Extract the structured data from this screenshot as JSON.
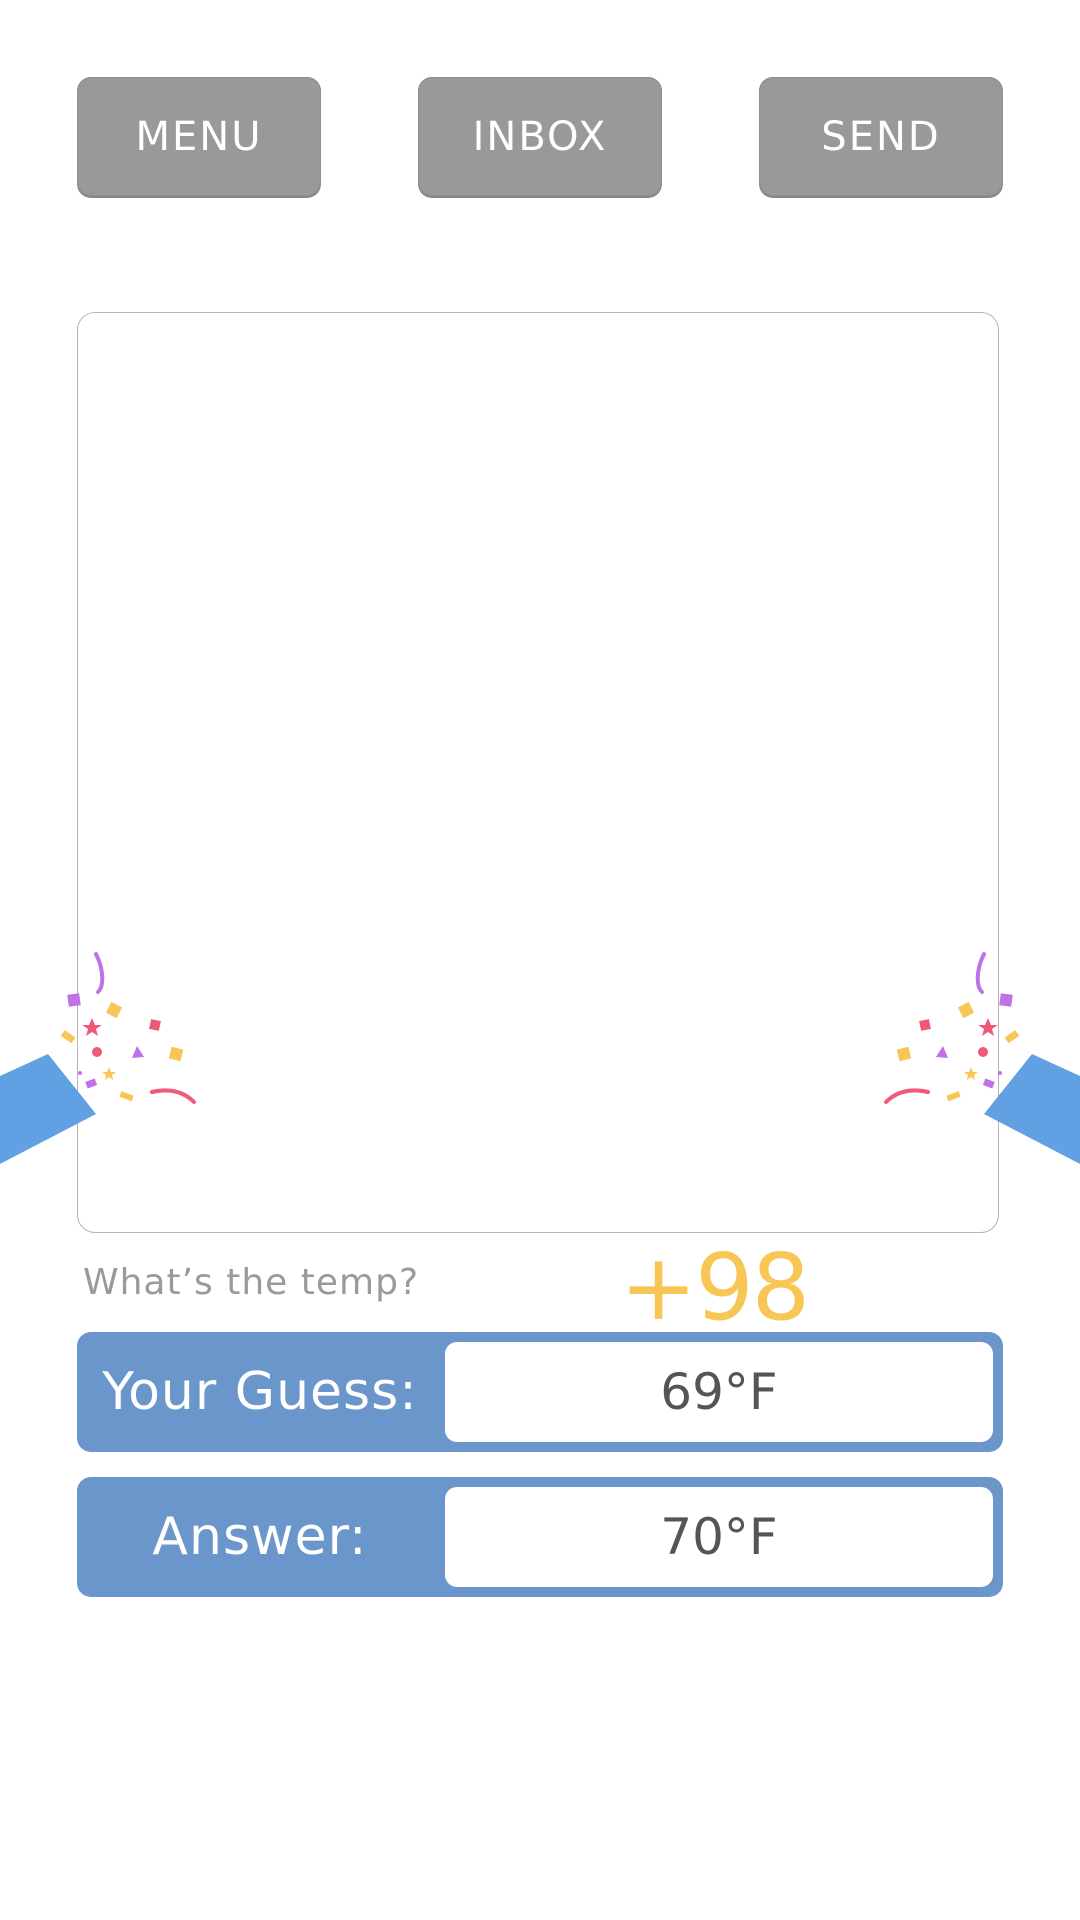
{
  "nav": {
    "menu_label": "MENU",
    "inbox_label": "INBOX",
    "send_label": "SEND"
  },
  "prompt": {
    "question": "What’s the temp?",
    "score": "+98"
  },
  "guess": {
    "label": "Your Guess:",
    "value": "69°F"
  },
  "answer": {
    "label": "Answer:",
    "value": "70°F"
  },
  "colors": {
    "button_gray": "#999999",
    "bar_blue": "#6a96cc",
    "score_yellow": "#f8c654",
    "popper_blue": "#62a0e4",
    "confetti_purple": "#c070e8",
    "confetti_yellow": "#f8c654",
    "confetti_pink": "#ee5a78"
  },
  "icons": {
    "left_popper": "party-popper-icon",
    "right_popper": "party-popper-icon"
  }
}
